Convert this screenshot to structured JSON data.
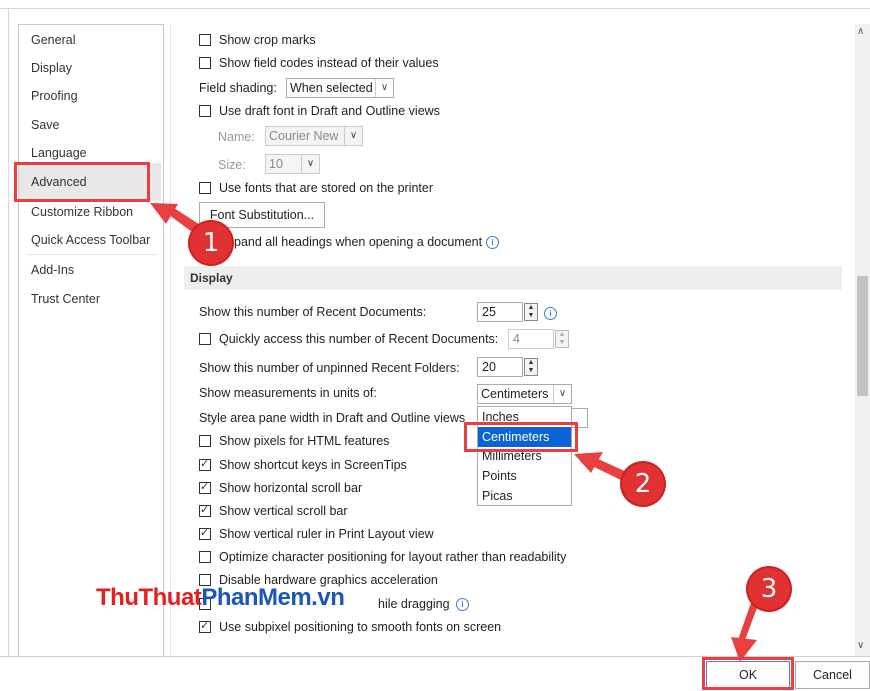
{
  "sidebar": {
    "items": [
      {
        "label": "General"
      },
      {
        "label": "Display"
      },
      {
        "label": "Proofing"
      },
      {
        "label": "Save"
      },
      {
        "label": "Language"
      },
      {
        "label": "Advanced"
      },
      {
        "label": "Customize Ribbon"
      },
      {
        "label": "Quick Access Toolbar"
      },
      {
        "label": "Add-Ins"
      },
      {
        "label": "Trust Center"
      }
    ],
    "selected": "Advanced"
  },
  "options": {
    "show_crop_marks": {
      "label": "Show crop marks",
      "checked": false
    },
    "show_field_codes": {
      "label": "Show field codes instead of their values",
      "checked": false
    },
    "field_shading": {
      "label": "Field shading:",
      "value": "When selected"
    },
    "draft_font": {
      "label": "Use draft font in Draft and Outline views",
      "checked": false
    },
    "name": {
      "label": "Name:",
      "value": "Courier New"
    },
    "size": {
      "label": "Size:",
      "value": "10"
    },
    "printer_fonts": {
      "label": "Use fonts that are stored on the printer",
      "checked": false
    },
    "font_substitution": {
      "label": "Font Substitution..."
    },
    "expand_headings": {
      "label": "pand all headings when opening a document"
    }
  },
  "display": {
    "header": "Display",
    "recent_documents": {
      "label": "Show this number of Recent Documents:",
      "value": "25"
    },
    "quick_access": {
      "label": "Quickly access this number of Recent Documents:",
      "value": "4",
      "checked": false
    },
    "unpinned_folders": {
      "label": "Show this number of unpinned Recent Folders:",
      "value": "20"
    },
    "measurement_units": {
      "label": "Show measurements in units of:",
      "value": "Centimeters"
    },
    "style_area": {
      "label": "Style area pane width in Draft and Outline views"
    },
    "checkboxes": [
      {
        "label": "Show pixels for HTML features",
        "checked": false
      },
      {
        "label": "Show shortcut keys in ScreenTips",
        "checked": true
      },
      {
        "label": "Show horizontal scroll bar",
        "checked": true
      },
      {
        "label": "Show vertical scroll bar",
        "checked": true
      },
      {
        "label": "Show vertical ruler in Print Layout view",
        "checked": true
      },
      {
        "label": "Optimize character positioning for layout rather than readability",
        "checked": false
      },
      {
        "label": "Disable hardware graphics acceleration",
        "checked": false
      },
      {
        "label": "hile dragging",
        "checked": false
      },
      {
        "label": "Use subpixel positioning to smooth fonts on screen",
        "checked": true
      }
    ]
  },
  "units_dropdown": {
    "options": [
      "Inches",
      "Centimeters",
      "Millimeters",
      "Points",
      "Picas"
    ],
    "selected": "Centimeters"
  },
  "buttons": {
    "ok": "OK",
    "cancel": "Cancel"
  },
  "annotations": {
    "step1": "1",
    "step2": "2",
    "step3": "3",
    "color": "#e03232"
  },
  "watermark": {
    "part1": "ThuThuat",
    "part2": "PhanMem",
    "part3": ".vn"
  }
}
